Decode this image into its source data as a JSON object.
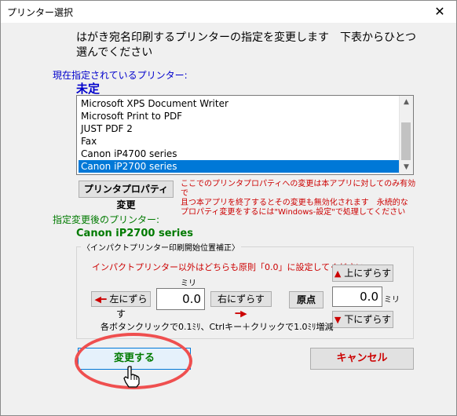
{
  "window": {
    "title": "プリンター選択",
    "close_glyph": "✕"
  },
  "instruction": [
    "はがき宛名印刷するプリンターの指定を変更します　下表からひとつ",
    "選んでください"
  ],
  "current": {
    "label": "現在指定されているプリンター:",
    "value": "未定"
  },
  "printers": {
    "items": [
      "Microsoft XPS Document Writer",
      "Microsoft Print to PDF",
      "JUST PDF 2",
      "Fax",
      "Canon iP4700 series",
      "Canon iP2700 series"
    ],
    "selected_index": 5
  },
  "properties_button": "プリンタプロパティ変更",
  "warning": [
    "ここでのプリンタプロパティへの変更は本アプリに対してのみ有効で",
    "且つ本アプリを終了するとその変更も無効化されます　永続的な",
    "プロパティ変更をするには\"Windows-設定\"で処理してください"
  ],
  "after": {
    "label": "指定変更後のプリンター:",
    "value": "Canon iP2700 series"
  },
  "offset": {
    "group_title": "〈インパクトプリンター印刷開始位置補正〉",
    "note": "インパクトプリンター以外はどちらも原則「0.0」に設定してください",
    "unit": "ミリ",
    "left_button": "左にずらす",
    "right_button": "右にずらす",
    "up_button": "上にずらす",
    "down_button": "下にずらす",
    "origin_button": "原点",
    "horizontal_value": "0.0",
    "vertical_value": "0.0",
    "hint": "各ボタンクリックで0.1ﾐﾘ、Ctrlキー＋クリックで1.0ﾐﾘ増減"
  },
  "ok_button": "変更する",
  "cancel_button": "キャンセル",
  "colors": {
    "accent_blue": "#0000cc",
    "green": "#007a00",
    "red": "#cc0000",
    "selection": "#0078d7",
    "highlight_ring": "#ef4f4f"
  },
  "icons": {
    "close": "close-icon",
    "arrow_left": "arrow-left-icon",
    "arrow_right": "arrow-right-icon",
    "arrow_up": "arrow-up-icon",
    "arrow_down": "arrow-down-icon",
    "cursor": "hand-cursor-icon"
  }
}
